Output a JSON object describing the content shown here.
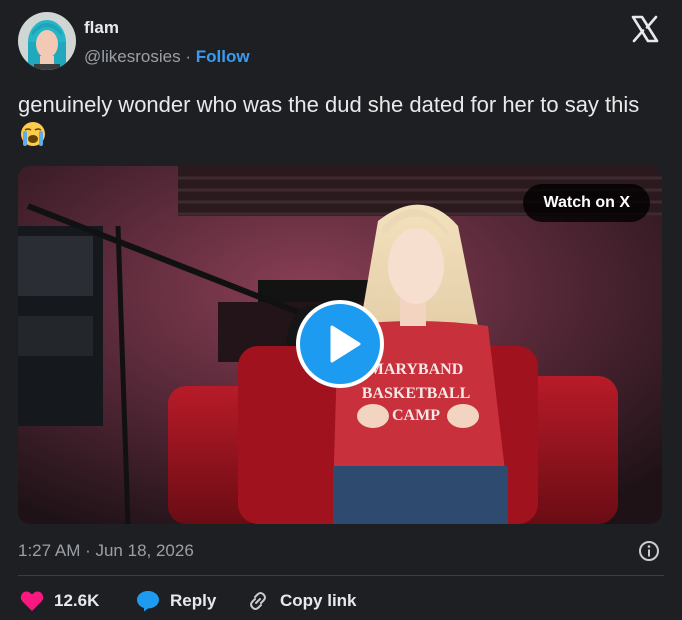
{
  "author": {
    "name": "flam",
    "handle": "@likesrosies",
    "separator": "·",
    "follow_label": "Follow"
  },
  "tweet": {
    "text": "genuinely wonder who was the dud she dated for her to say this",
    "emoji": "loudly-crying-face"
  },
  "media": {
    "watch_label": "Watch on X",
    "shirt_text_lines": [
      "MARYBAND",
      "BASKETBALL",
      "CAMP"
    ]
  },
  "meta": {
    "timestamp": "1:27 AM · Jun 18, 2026"
  },
  "actions": {
    "like_count": "12.6K",
    "reply_label": "Reply",
    "copy_label": "Copy link"
  },
  "colors": {
    "background": "#1e1f22",
    "accent": "#1d9bf0",
    "follow": "#3a9cf0",
    "like": "#f91880",
    "muted": "#9aa0a6"
  }
}
